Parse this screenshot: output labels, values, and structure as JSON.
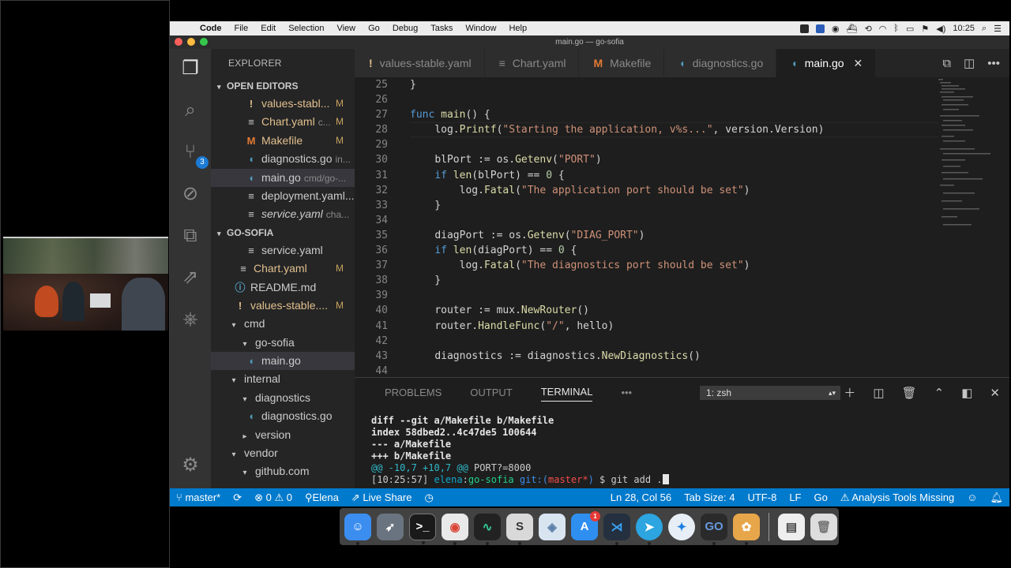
{
  "menubar": {
    "app": "Code",
    "items": [
      "File",
      "Edit",
      "Selection",
      "View",
      "Go",
      "Debug",
      "Tasks",
      "Window",
      "Help"
    ],
    "clock": "10:25"
  },
  "window_title": "main.go — go-sofia",
  "activity_badge": "3",
  "explorer": {
    "title": "EXPLORER",
    "open_editors_label": "OPEN EDITORS",
    "open_editors": [
      {
        "icon": "!",
        "name": "values-stabl...",
        "desc": "",
        "mark": "M"
      },
      {
        "icon": "≡",
        "name": "Chart.yaml",
        "desc": "c...",
        "mark": "M"
      },
      {
        "icon": "M",
        "name": "Makefile",
        "desc": "",
        "mark": "M"
      },
      {
        "icon": "◖",
        "name": "diagnostics.go",
        "desc": "in...",
        "mark": ""
      },
      {
        "icon": "◖",
        "name": "main.go",
        "desc": "cmd/go-...",
        "mark": ""
      },
      {
        "icon": "≡",
        "name": "deployment.yaml...",
        "desc": "",
        "mark": ""
      },
      {
        "icon": "≡",
        "name": "service.yaml",
        "desc": "cha...",
        "mark": ""
      }
    ],
    "project_label": "GO-SOFIA",
    "tree": [
      {
        "icon": "≡",
        "name": "service.yaml",
        "mark": ""
      },
      {
        "icon": "≡",
        "name": "Chart.yaml",
        "mark": "M"
      },
      {
        "icon": "ⓘ",
        "name": "README.md",
        "mark": ""
      },
      {
        "icon": "!",
        "name": "values-stable....",
        "mark": "M"
      },
      {
        "icon": "▾",
        "name": "cmd",
        "mark": ""
      },
      {
        "icon": "▾",
        "name": "go-sofia",
        "mark": ""
      },
      {
        "icon": "◖",
        "name": "main.go",
        "mark": ""
      },
      {
        "icon": "▾",
        "name": "internal",
        "mark": ""
      },
      {
        "icon": "▾",
        "name": "diagnostics",
        "mark": ""
      },
      {
        "icon": "◖",
        "name": "diagnostics.go",
        "mark": ""
      },
      {
        "icon": "▸",
        "name": "version",
        "mark": ""
      },
      {
        "icon": "▾",
        "name": "vendor",
        "mark": ""
      },
      {
        "icon": "▾",
        "name": "github.com",
        "mark": ""
      }
    ]
  },
  "tabs": [
    {
      "icon": "!",
      "label": "values-stable.yaml"
    },
    {
      "icon": "≡",
      "label": "Chart.yaml"
    },
    {
      "icon": "M",
      "label": "Makefile"
    },
    {
      "icon": "◖",
      "label": "diagnostics.go"
    },
    {
      "icon": "◖",
      "label": "main.go"
    }
  ],
  "code_lines": [
    {
      "n": "25",
      "text": "}"
    },
    {
      "n": "26",
      "text": ""
    },
    {
      "n": "27",
      "text": "func main() {"
    },
    {
      "n": "28",
      "text": "    log.Printf(\"Starting the application, v%s...\", version.Version)"
    },
    {
      "n": "29",
      "text": ""
    },
    {
      "n": "30",
      "text": "    blPort := os.Getenv(\"PORT\")"
    },
    {
      "n": "31",
      "text": "    if len(blPort) == 0 {"
    },
    {
      "n": "32",
      "text": "        log.Fatal(\"The application port should be set\")"
    },
    {
      "n": "33",
      "text": "    }"
    },
    {
      "n": "34",
      "text": ""
    },
    {
      "n": "35",
      "text": "    diagPort := os.Getenv(\"DIAG_PORT\")"
    },
    {
      "n": "36",
      "text": "    if len(diagPort) == 0 {"
    },
    {
      "n": "37",
      "text": "        log.Fatal(\"The diagnostics port should be set\")"
    },
    {
      "n": "38",
      "text": "    }"
    },
    {
      "n": "39",
      "text": ""
    },
    {
      "n": "40",
      "text": "    router := mux.NewRouter()"
    },
    {
      "n": "41",
      "text": "    router.HandleFunc(\"/\", hello)"
    },
    {
      "n": "42",
      "text": ""
    },
    {
      "n": "43",
      "text": "    diagnostics := diagnostics.NewDiagnostics()"
    },
    {
      "n": "44",
      "text": ""
    }
  ],
  "panel": {
    "tabs": [
      "PROBLEMS",
      "OUTPUT",
      "TERMINAL"
    ],
    "more": "•••",
    "shell": "1: zsh"
  },
  "terminal": {
    "l1": "diff --git a/Makefile b/Makefile",
    "l2": "index 58dbed2..4c47de5 100644",
    "l3": "--- a/Makefile",
    "l4": "+++ b/Makefile",
    "l5_hunk": "@@ -10,7 +10,7 @@",
    "l5_rest": " PORT?=8000",
    "p_time": "[10:25:57]",
    "p_user": "elena",
    "p_sep": ":",
    "p_dir": "go-sofia",
    "p_git": " git:(",
    "p_branch": "master*",
    "p_git_end": ")",
    "p_cmd": " $ git add ."
  },
  "status": {
    "branch": "master*",
    "errors": "0",
    "warnings": "0",
    "user": "Elena",
    "live_share": "Live Share",
    "position": "Ln 28, Col 56",
    "tab_size": "Tab Size: 4",
    "encoding": "UTF-8",
    "eol": "LF",
    "language": "Go",
    "analysis": "Analysis Tools Missing"
  },
  "dock": {
    "calendar_badge": "1"
  }
}
